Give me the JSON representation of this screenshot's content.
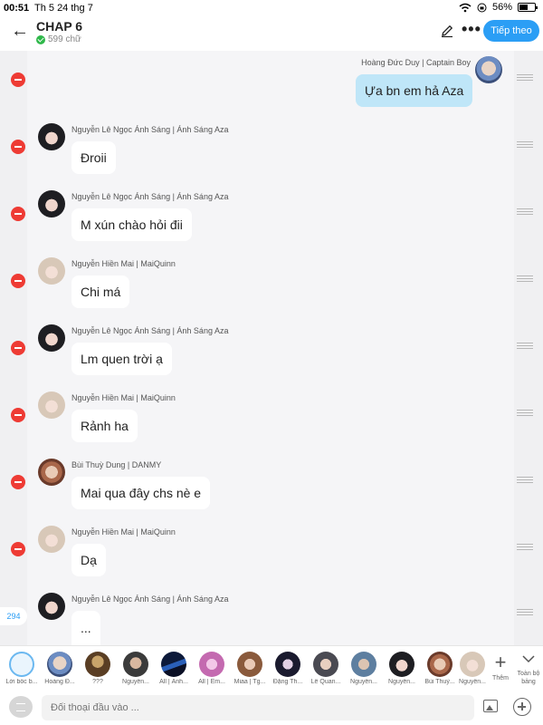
{
  "status_bar": {
    "time": "00:51",
    "date": "Th 5 24 thg 7",
    "battery": "56%"
  },
  "header": {
    "title": "CHAP 6",
    "word_count": "599 chữ",
    "next_label": "Tiếp theo"
  },
  "messages": [
    {
      "sender": "Hoàng Đức Duy | Captain Boy",
      "text": "Ựa bn em hả Aza",
      "self": true
    },
    {
      "sender": "Nguyễn Lê Ngọc Ánh Sáng | Ánh Sáng Aza",
      "text": "Đroii",
      "self": false
    },
    {
      "sender": "Nguyễn Lê Ngọc Ánh Sáng | Ánh Sáng Aza",
      "text": "M xún chào hỏi đii",
      "self": false
    },
    {
      "sender": "Nguyễn Hiền Mai | MaiQuinn",
      "text": "Chi má",
      "self": false
    },
    {
      "sender": "Nguyễn Lê Ngọc Ánh Sáng | Ánh Sáng Aza",
      "text": "Lm quen trời ạ",
      "self": false
    },
    {
      "sender": "Nguyễn Hiền Mai | MaiQuinn",
      "text": "Rảnh ha",
      "self": false
    },
    {
      "sender": "Bùi Thuỳ Dung | DANMY",
      "text": "Mai qua đây chs nè e",
      "self": false
    },
    {
      "sender": "Nguyễn Hiền Mai | MaiQuinn",
      "text": "Dạ",
      "self": false
    },
    {
      "sender": "Nguyễn Lê Ngọc Ánh Sáng | Ánh Sáng Aza",
      "text": "...",
      "self": false
    }
  ],
  "message_count": "294",
  "characters": [
    {
      "name": "Lời bốc b..."
    },
    {
      "name": "Hoàng Đ..."
    },
    {
      "name": "???"
    },
    {
      "name": "Nguyễn..."
    },
    {
      "name": "All | Ánh..."
    },
    {
      "name": "All | Em..."
    },
    {
      "name": "Miaa | Tg..."
    },
    {
      "name": "Đặng Th..."
    },
    {
      "name": "Lê Quan..."
    },
    {
      "name": "Nguyễn..."
    },
    {
      "name": "Nguyễn..."
    },
    {
      "name": "Bùi Thuỳ..."
    },
    {
      "name": "Nguyễn..."
    }
  ],
  "add_label": "Thêm",
  "all_label": "Toàn bộ bảng",
  "input": {
    "placeholder": "Đối thoại đầu vào ..."
  },
  "colors": {
    "accent": "#2b9ef5",
    "self_bubble": "#bfe6f8",
    "delete": "#ee3b34"
  }
}
